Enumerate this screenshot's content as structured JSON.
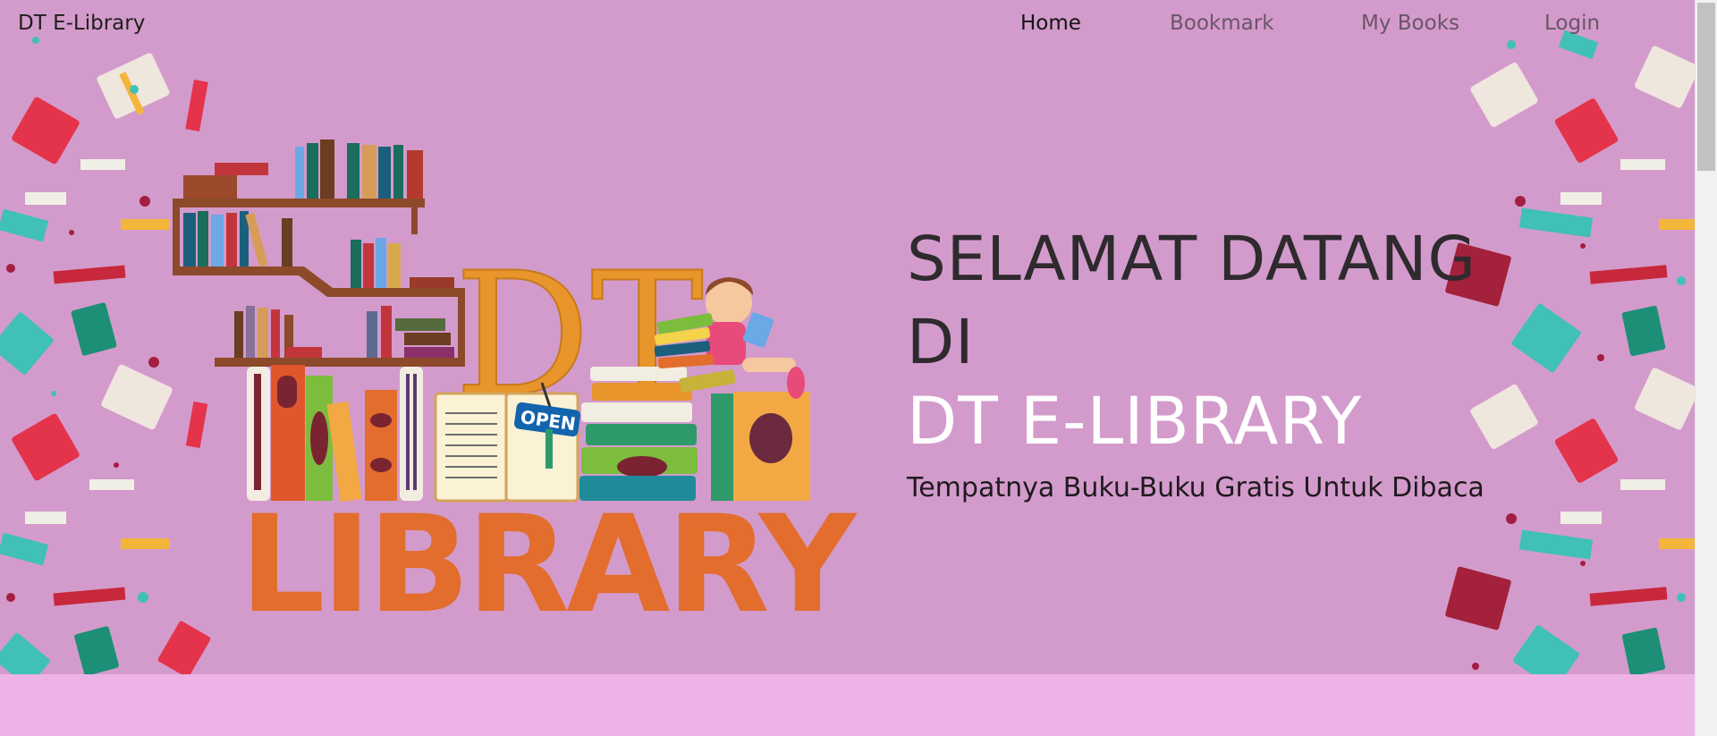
{
  "navbar": {
    "brand": "DT E-Library",
    "links": [
      {
        "label": "Home",
        "active": true
      },
      {
        "label": "Bookmark",
        "active": false
      },
      {
        "label": "My Books",
        "active": false
      },
      {
        "label": "Login",
        "active": false
      }
    ]
  },
  "hero": {
    "title_line1": "SELAMAT DATANG",
    "title_line2": "DI",
    "site_name": "DT E-LIBRARY",
    "tagline": "Tempatnya Buku-Buku Gratis Untuk Dibaca",
    "illustration": {
      "letters_top": "DT",
      "open_sign": "OPEN",
      "letters_bottom": "LIBRARY"
    }
  },
  "colors": {
    "hero_bg": "#d39bcb",
    "lower_bg": "#eeb3e6",
    "title": "#2e2a2e",
    "site_name": "#ffffff"
  }
}
